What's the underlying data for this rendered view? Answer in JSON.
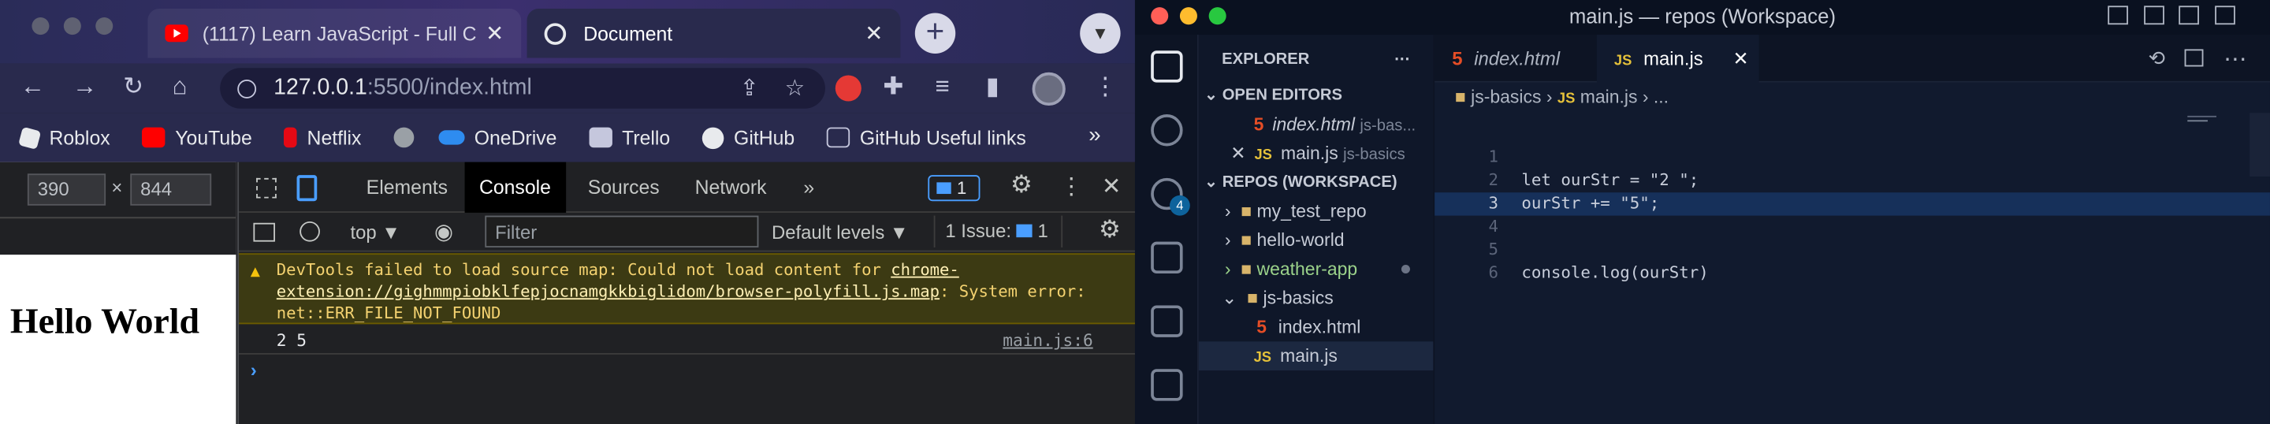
{
  "chrome": {
    "tabs": [
      {
        "title": "(1117) Learn JavaScript - Full C",
        "icon": "youtube-icon",
        "active": false
      },
      {
        "title": "Document",
        "icon": "globe-icon",
        "active": true
      }
    ],
    "url_host": "127.0.0.1",
    "url_path": ":5500/index.html",
    "bookmarks": [
      {
        "label": "Roblox",
        "icon": "roblox-icon"
      },
      {
        "label": "YouTube",
        "icon": "youtube-icon"
      },
      {
        "label": "Netflix",
        "icon": "netflix-icon"
      },
      {
        "label": "",
        "icon": "globe-icon"
      },
      {
        "label": "OneDrive",
        "icon": "onedrive-icon"
      },
      {
        "label": "Trello",
        "icon": "trello-icon"
      },
      {
        "label": "GitHub",
        "icon": "github-icon"
      },
      {
        "label": "GitHub Useful links",
        "icon": "folder-icon"
      }
    ],
    "bookmarks_more": "»",
    "viewport_width": "390",
    "viewport_height": "844",
    "viewport_x": "×",
    "page_heading": "Hello World"
  },
  "devtools": {
    "tabs": [
      "Elements",
      "Console",
      "Sources",
      "Network"
    ],
    "more_tabs": "»",
    "messages_badge": "1",
    "context": "top ▼",
    "filter_placeholder": "Filter",
    "levels": "Default levels ▼",
    "issues_label": "1 Issue:",
    "issues_count": "1",
    "warning_prefix": "DevTools failed to load source map: Could not load content for ",
    "warning_link": "chrome-extension://gighmmpiobklfepjocnamgkkbiglidom/browser-polyfill.js.map",
    "warning_suffix": ": System error: net::ERR_FILE_NOT_FOUND",
    "log_output": "2 5",
    "log_source": "main.js:6",
    "prompt": "›"
  },
  "vscode": {
    "window_title": "main.js — repos (Workspace)",
    "explorer_title": "EXPLORER",
    "open_editors_title": "OPEN EDITORS",
    "open_editors": [
      {
        "name": "index.html",
        "path": "js-bas...",
        "type": "html"
      },
      {
        "name": "main.js",
        "path": "js-basics",
        "type": "js"
      }
    ],
    "workspace_title": "REPOS (WORKSPACE)",
    "tree": [
      {
        "name": "my_test_repo",
        "depth": 1,
        "kind": "folder"
      },
      {
        "name": "hello-world",
        "depth": 1,
        "kind": "folder"
      },
      {
        "name": "weather-app",
        "depth": 1,
        "kind": "folder"
      },
      {
        "name": "js-basics",
        "depth": 1,
        "kind": "folder-open"
      },
      {
        "name": "index.html",
        "depth": 2,
        "kind": "html"
      },
      {
        "name": "main.js",
        "depth": 2,
        "kind": "js"
      }
    ],
    "scm_badge": "4",
    "editor_tabs": [
      {
        "label": "index.html",
        "type": "html",
        "active": false
      },
      {
        "label": "main.js",
        "type": "js",
        "active": true
      }
    ],
    "breadcrumb": [
      "js-basics",
      "main.js",
      "..."
    ],
    "code_lines": [
      {
        "n": "1",
        "text": ""
      },
      {
        "n": "2",
        "text": "let ourStr = \"2 \";"
      },
      {
        "n": "3",
        "text": "ourStr += \"5\";"
      },
      {
        "n": "4",
        "text": ""
      },
      {
        "n": "5",
        "text": ""
      },
      {
        "n": "6",
        "text": "console.log(ourStr)"
      }
    ],
    "colors": {
      "accent": "#0e639c",
      "selection": "#16305a"
    }
  }
}
